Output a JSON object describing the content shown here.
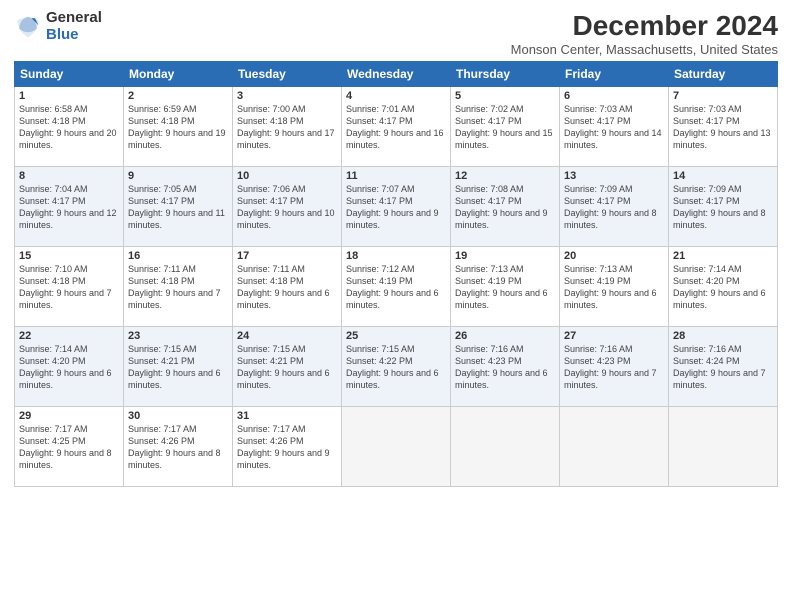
{
  "logo": {
    "general": "General",
    "blue": "Blue"
  },
  "title": "December 2024",
  "subtitle": "Monson Center, Massachusetts, United States",
  "headers": [
    "Sunday",
    "Monday",
    "Tuesday",
    "Wednesday",
    "Thursday",
    "Friday",
    "Saturday"
  ],
  "weeks": [
    [
      {
        "day": "1",
        "sunrise": "6:58 AM",
        "sunset": "4:18 PM",
        "daylight": "9 hours and 20 minutes."
      },
      {
        "day": "2",
        "sunrise": "6:59 AM",
        "sunset": "4:18 PM",
        "daylight": "9 hours and 19 minutes."
      },
      {
        "day": "3",
        "sunrise": "7:00 AM",
        "sunset": "4:18 PM",
        "daylight": "9 hours and 17 minutes."
      },
      {
        "day": "4",
        "sunrise": "7:01 AM",
        "sunset": "4:17 PM",
        "daylight": "9 hours and 16 minutes."
      },
      {
        "day": "5",
        "sunrise": "7:02 AM",
        "sunset": "4:17 PM",
        "daylight": "9 hours and 15 minutes."
      },
      {
        "day": "6",
        "sunrise": "7:03 AM",
        "sunset": "4:17 PM",
        "daylight": "9 hours and 14 minutes."
      },
      {
        "day": "7",
        "sunrise": "7:03 AM",
        "sunset": "4:17 PM",
        "daylight": "9 hours and 13 minutes."
      }
    ],
    [
      {
        "day": "8",
        "sunrise": "7:04 AM",
        "sunset": "4:17 PM",
        "daylight": "9 hours and 12 minutes."
      },
      {
        "day": "9",
        "sunrise": "7:05 AM",
        "sunset": "4:17 PM",
        "daylight": "9 hours and 11 minutes."
      },
      {
        "day": "10",
        "sunrise": "7:06 AM",
        "sunset": "4:17 PM",
        "daylight": "9 hours and 10 minutes."
      },
      {
        "day": "11",
        "sunrise": "7:07 AM",
        "sunset": "4:17 PM",
        "daylight": "9 hours and 9 minutes."
      },
      {
        "day": "12",
        "sunrise": "7:08 AM",
        "sunset": "4:17 PM",
        "daylight": "9 hours and 9 minutes."
      },
      {
        "day": "13",
        "sunrise": "7:09 AM",
        "sunset": "4:17 PM",
        "daylight": "9 hours and 8 minutes."
      },
      {
        "day": "14",
        "sunrise": "7:09 AM",
        "sunset": "4:17 PM",
        "daylight": "9 hours and 8 minutes."
      }
    ],
    [
      {
        "day": "15",
        "sunrise": "7:10 AM",
        "sunset": "4:18 PM",
        "daylight": "9 hours and 7 minutes."
      },
      {
        "day": "16",
        "sunrise": "7:11 AM",
        "sunset": "4:18 PM",
        "daylight": "9 hours and 7 minutes."
      },
      {
        "day": "17",
        "sunrise": "7:11 AM",
        "sunset": "4:18 PM",
        "daylight": "9 hours and 6 minutes."
      },
      {
        "day": "18",
        "sunrise": "7:12 AM",
        "sunset": "4:19 PM",
        "daylight": "9 hours and 6 minutes."
      },
      {
        "day": "19",
        "sunrise": "7:13 AM",
        "sunset": "4:19 PM",
        "daylight": "9 hours and 6 minutes."
      },
      {
        "day": "20",
        "sunrise": "7:13 AM",
        "sunset": "4:19 PM",
        "daylight": "9 hours and 6 minutes."
      },
      {
        "day": "21",
        "sunrise": "7:14 AM",
        "sunset": "4:20 PM",
        "daylight": "9 hours and 6 minutes."
      }
    ],
    [
      {
        "day": "22",
        "sunrise": "7:14 AM",
        "sunset": "4:20 PM",
        "daylight": "9 hours and 6 minutes."
      },
      {
        "day": "23",
        "sunrise": "7:15 AM",
        "sunset": "4:21 PM",
        "daylight": "9 hours and 6 minutes."
      },
      {
        "day": "24",
        "sunrise": "7:15 AM",
        "sunset": "4:21 PM",
        "daylight": "9 hours and 6 minutes."
      },
      {
        "day": "25",
        "sunrise": "7:15 AM",
        "sunset": "4:22 PM",
        "daylight": "9 hours and 6 minutes."
      },
      {
        "day": "26",
        "sunrise": "7:16 AM",
        "sunset": "4:23 PM",
        "daylight": "9 hours and 6 minutes."
      },
      {
        "day": "27",
        "sunrise": "7:16 AM",
        "sunset": "4:23 PM",
        "daylight": "9 hours and 7 minutes."
      },
      {
        "day": "28",
        "sunrise": "7:16 AM",
        "sunset": "4:24 PM",
        "daylight": "9 hours and 7 minutes."
      }
    ],
    [
      {
        "day": "29",
        "sunrise": "7:17 AM",
        "sunset": "4:25 PM",
        "daylight": "9 hours and 8 minutes."
      },
      {
        "day": "30",
        "sunrise": "7:17 AM",
        "sunset": "4:26 PM",
        "daylight": "9 hours and 8 minutes."
      },
      {
        "day": "31",
        "sunrise": "7:17 AM",
        "sunset": "4:26 PM",
        "daylight": "9 hours and 9 minutes."
      },
      null,
      null,
      null,
      null
    ]
  ],
  "labels": {
    "sunrise": "Sunrise:",
    "sunset": "Sunset:",
    "daylight": "Daylight:"
  }
}
